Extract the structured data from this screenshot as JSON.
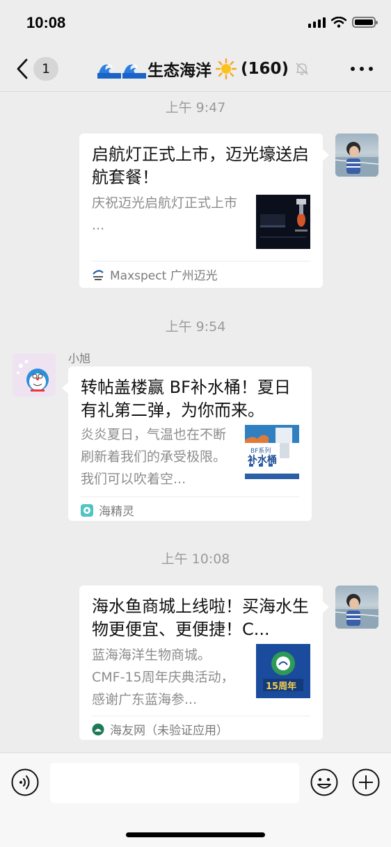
{
  "status_bar": {
    "time": "10:08"
  },
  "nav": {
    "back_count": "1",
    "title": "生态海洋",
    "member_count": "(160)",
    "icons": [
      "back-chevron-icon",
      "wave-icon",
      "sun-icon",
      "mute-bell-icon",
      "more-icon"
    ]
  },
  "messages": [
    {
      "timestamp": "上午 9:47",
      "sender": "me",
      "title": "启航灯正式上市，迈光壕送启航套餐！",
      "description": "庆祝迈光启航灯正式上市\n...",
      "source": "Maxspect 广州迈光",
      "source_icon": "maxspect-logo-icon"
    },
    {
      "timestamp": "上午 9:54",
      "sender": "小旭",
      "title": "转帖盖楼赢 BF补水桶！夏日有礼第二弹，为你而来。",
      "description": "炎炎夏日，气温也在不断刷新着我们的承受极限。我们可以吹着空...",
      "thumb_text": "补水桶",
      "thumb_tag": "BF系列",
      "source": "海精灵",
      "source_icon": "haijingling-logo-icon"
    },
    {
      "timestamp": "上午 10:08",
      "sender": "me",
      "title": "海水鱼商城上线啦！买海水生物更便宜、更便捷！C...",
      "description": "蓝海海洋生物商城。CMF-15周年庆典活动，感谢广东蓝海参...",
      "thumb_text": "15周年",
      "source": "海友网（未验证应用）",
      "source_icon": "haiyou-logo-icon"
    }
  ],
  "input_bar": {
    "placeholder": "",
    "icons": [
      "voice-icon",
      "emoji-icon",
      "plus-icon"
    ]
  },
  "colors": {
    "background": "#ededed",
    "card": "#ffffff",
    "muted_text": "#8c8c8c",
    "timestamp": "#9a9a9a"
  }
}
